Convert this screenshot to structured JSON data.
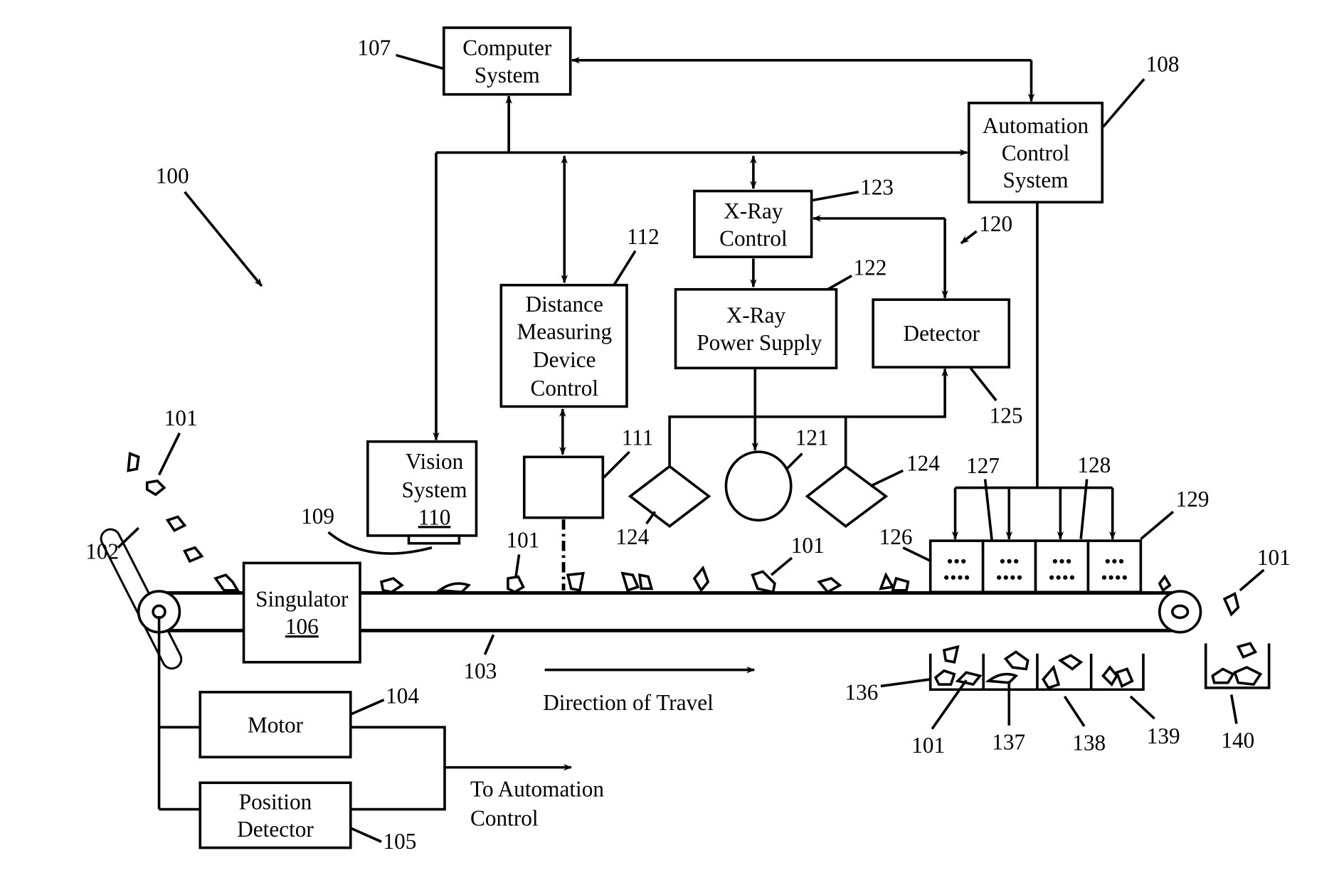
{
  "figure": {
    "system_ref": "100",
    "blocks": {
      "computer_system": {
        "lines": [
          "Computer",
          "System"
        ],
        "ref": "107"
      },
      "automation_control": {
        "lines": [
          "Automation",
          "Control",
          "System"
        ],
        "ref": "108"
      },
      "xray_control": {
        "lines": [
          "X-Ray",
          "Control"
        ],
        "ref": "123"
      },
      "xray_power": {
        "lines": [
          "X-Ray",
          "Power Supply"
        ],
        "ref": "122"
      },
      "detector": {
        "label": "Detector",
        "ref": "125"
      },
      "distance_control": {
        "lines": [
          "Distance",
          "Measuring",
          "Device",
          "Control"
        ],
        "ref": "112"
      },
      "distance_device": {
        "ref": "111"
      },
      "vision_system": {
        "lines": [
          "Vision",
          "System"
        ],
        "num": "110"
      },
      "camera": {
        "ref": "109"
      },
      "singulator": {
        "label": "Singulator",
        "num": "106"
      },
      "motor": {
        "label": "Motor",
        "ref": "104"
      },
      "position_detector": {
        "lines": [
          "Position",
          "Detector"
        ],
        "ref": "105"
      }
    },
    "xray_subsystem_ref": "120",
    "xray_source_ref": "121",
    "detector_element_ref": "124",
    "feeder_ref": "102",
    "conveyor_ref": "103",
    "material_ref": "101",
    "sorter_refs": {
      "array": "126",
      "a": "127",
      "b": "128",
      "c": "129"
    },
    "bins": {
      "refs": [
        "136",
        "137",
        "138",
        "139",
        "140"
      ],
      "item_ref": "101"
    },
    "labels": {
      "direction": "Direction of Travel",
      "to_automation": [
        "To Automation",
        "Control"
      ]
    }
  }
}
